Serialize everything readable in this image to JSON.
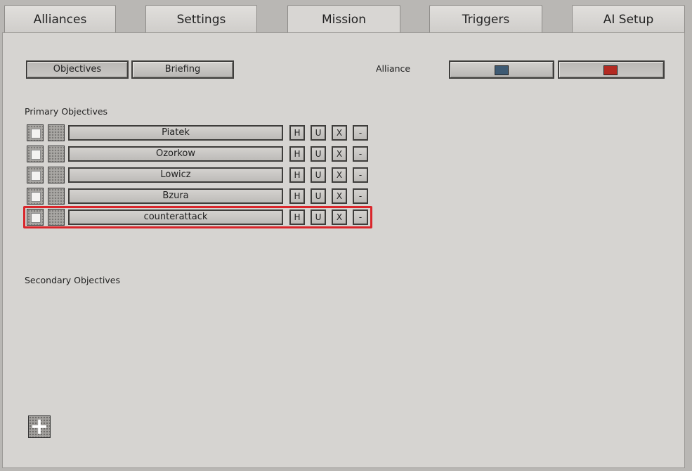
{
  "tabs": [
    {
      "label": "Alliances",
      "active": false
    },
    {
      "label": "Settings",
      "active": false
    },
    {
      "label": "Mission",
      "active": true
    },
    {
      "label": "Triggers",
      "active": false
    },
    {
      "label": "AI Setup",
      "active": false
    }
  ],
  "subtabs": {
    "objectives": "Objectives",
    "briefing": "Briefing"
  },
  "alliance": {
    "label": "Alliance",
    "colors": [
      "#3e5a73",
      "#b32a22"
    ]
  },
  "primary": {
    "heading": "Primary Objectives",
    "objectives": [
      {
        "name": "Piatek"
      },
      {
        "name": "Ozorkow"
      },
      {
        "name": "Lowicz"
      },
      {
        "name": "Bzura"
      },
      {
        "name": "counterattack"
      }
    ],
    "actions": [
      "H",
      "U",
      "X",
      "-"
    ]
  },
  "secondary": {
    "heading": "Secondary Objectives"
  },
  "add_icon": "plus-icon",
  "highlight_color": "#d9262b"
}
